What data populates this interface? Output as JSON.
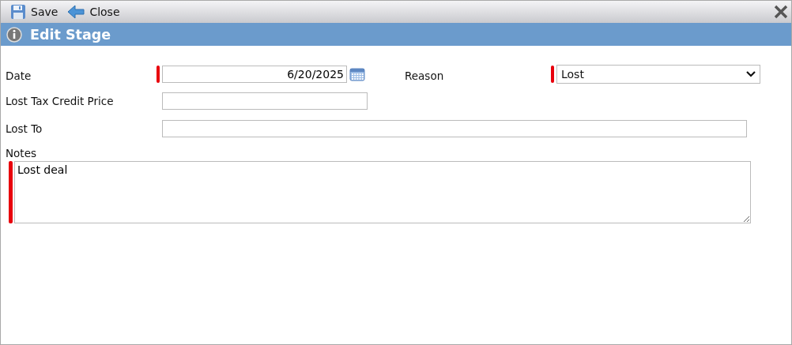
{
  "toolbar": [
    {
      "kind": "save",
      "label": "Save"
    },
    {
      "kind": "close",
      "label": "Close"
    }
  ],
  "title": "Edit Stage",
  "fields": [
    {
      "kind": "date",
      "label": "Date",
      "value": "6/20/2025",
      "required": true
    },
    {
      "kind": "select",
      "label": "Reason",
      "value": "Lost",
      "required": true
    },
    {
      "kind": "text",
      "label": "Lost Tax Credit Price",
      "required": false
    },
    {
      "kind": "text",
      "label": "Lost To",
      "required": false
    },
    {
      "kind": "textarea",
      "label": "Notes",
      "value": "Lost deal",
      "required": true
    }
  ]
}
